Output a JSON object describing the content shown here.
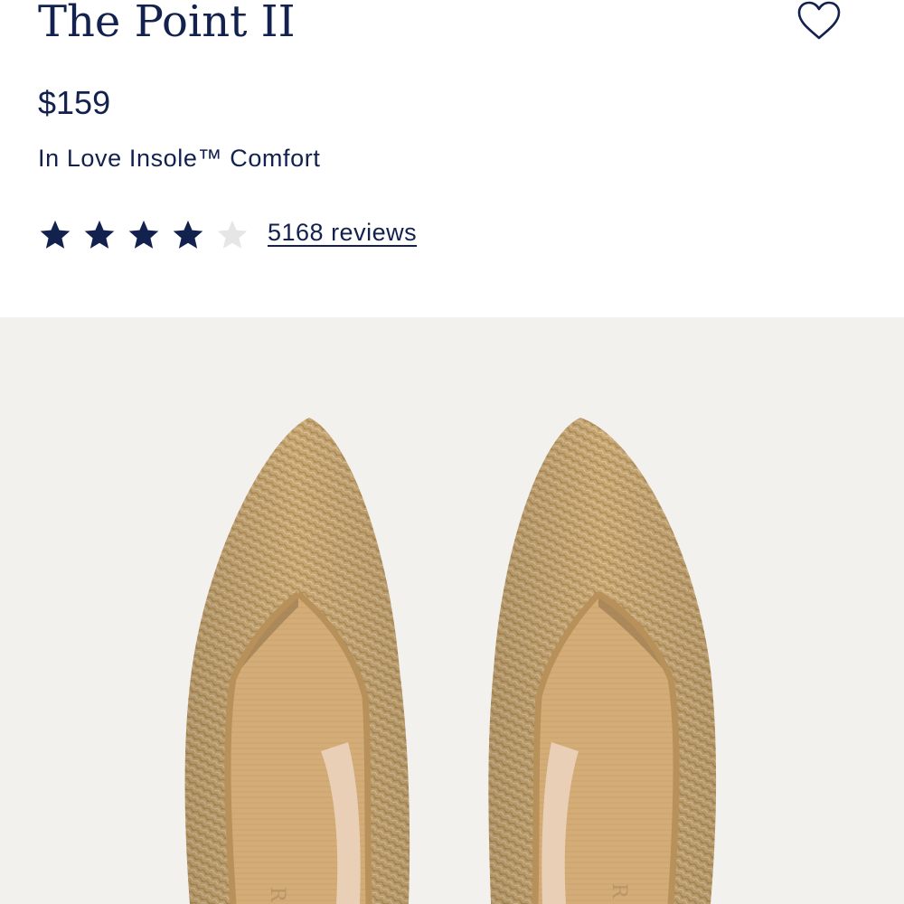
{
  "product": {
    "title": "The Point II",
    "price": "$159",
    "subtitle": "In Love Insole™ Comfort"
  },
  "rating": {
    "value": 4,
    "max": 5,
    "reviews_label": "5168 reviews"
  },
  "icons": {
    "wishlist": "heart-outline-icon",
    "star": "star-icon"
  },
  "colors": {
    "text": "#13214f",
    "star_filled": "#13214f",
    "star_empty": "#e6e6e6",
    "gallery_bg": "#f2f1ee",
    "knit": "#c8a674",
    "insole": "#d2ab77"
  },
  "gallery": {
    "insole_brand_mark": "R"
  }
}
